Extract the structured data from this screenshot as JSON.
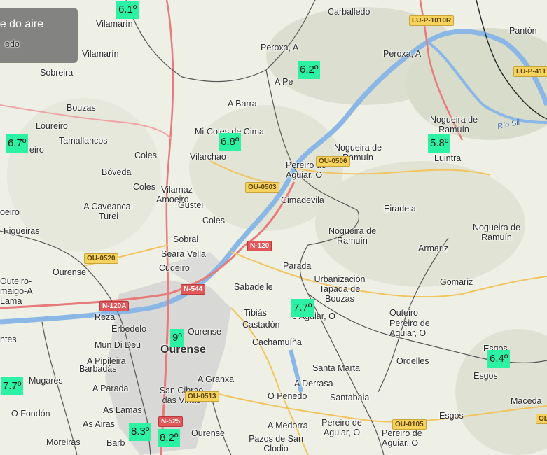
{
  "panel": {
    "title": "ade do aire"
  },
  "places": [
    {
      "id": "carballedo",
      "text": "Carballedo"
    },
    {
      "id": "panton",
      "text": "Pantón"
    },
    {
      "id": "peroxa-a-1",
      "text": "Peroxa, A"
    },
    {
      "id": "peroxa-a-2",
      "text": "Peroxa, A"
    },
    {
      "id": "vilamarin-1",
      "text": "Vilamarín"
    },
    {
      "id": "vilamarin-2",
      "text": "Vilamarín"
    },
    {
      "id": "edo",
      "text": "edo"
    },
    {
      "id": "sobreira",
      "text": "Sobreira"
    },
    {
      "id": "a-pereira",
      "text": "A Pe"
    },
    {
      "id": "a-barra",
      "text": "A Barra"
    },
    {
      "id": "bouzas",
      "text": "Bouzas"
    },
    {
      "id": "loureiro",
      "text": "Loureiro"
    },
    {
      "id": "coles-cima",
      "text": "Coles de Cima"
    },
    {
      "id": "micoles",
      "text": "Mi"
    },
    {
      "id": "nogueira-1",
      "text": "Nogueira de Ramuín"
    },
    {
      "id": "tamallancos",
      "text": "Tamallancos"
    },
    {
      "id": "coles-1",
      "text": "Coles"
    },
    {
      "id": "vilarchao",
      "text": "Vilarchao"
    },
    {
      "id": "nogueira-2",
      "text": "Nogueira de Ramuín"
    },
    {
      "id": "luintra",
      "text": "Luintra"
    },
    {
      "id": "loureiro-frag",
      "text": "eiro"
    },
    {
      "id": "pereiro-1",
      "text": "Pereiro de Aguiar, O"
    },
    {
      "id": "boveda",
      "text": "Bóveda"
    },
    {
      "id": "coles-2",
      "text": "Coles"
    },
    {
      "id": "vilarnaz",
      "text": "Vilarnaz"
    },
    {
      "id": "amoeiro",
      "text": "Amoeiro"
    },
    {
      "id": "gustei",
      "text": "Gustei"
    },
    {
      "id": "cimadevila",
      "text": "Cimadevila"
    },
    {
      "id": "eirig",
      "text": "oeiro"
    },
    {
      "id": "a-caveanca",
      "text": "A Caveanca-Turei"
    },
    {
      "id": "eirada",
      "text": "Eiradela"
    },
    {
      "id": "figueiras",
      "text": "Figueiras"
    },
    {
      "id": "coles-3",
      "text": "Coles"
    },
    {
      "id": "nogueira-3",
      "text": "Nogueira de Ramuín"
    },
    {
      "id": "nogueira-4",
      "text": "Nogueira de Ramuín"
    },
    {
      "id": "sobral",
      "text": "Sobral"
    },
    {
      "id": "seara-vella",
      "text": "Seara Vella"
    },
    {
      "id": "armariz",
      "text": "Armariz"
    },
    {
      "id": "outeiro-maigo",
      "text": "Outeiro-maigo-A Lama"
    },
    {
      "id": "ourense-1",
      "text": "Ourense"
    },
    {
      "id": "cudeiro",
      "text": "Cudeiro"
    },
    {
      "id": "parada",
      "text": "Parada"
    },
    {
      "id": "urbanizacion",
      "text": "Urbanización Tapada de Bouzas"
    },
    {
      "id": "gomariz",
      "text": "Gomariz"
    },
    {
      "id": "sabadelle",
      "text": "Sabadelle"
    },
    {
      "id": "outeiro-pereiro",
      "text": "Outeiro"
    },
    {
      "id": "pereiro-2",
      "text": "Pereiro de Aguiar, O"
    },
    {
      "id": "tibias",
      "text": "Tibiás"
    },
    {
      "id": "reza",
      "text": "Reza"
    },
    {
      "id": "castadon",
      "text": "Castadón"
    },
    {
      "id": "aguiar-frag",
      "text": "e Aguiar, O"
    },
    {
      "id": "ntes",
      "text": "ntes"
    },
    {
      "id": "erbedelo",
      "text": "Erbedelo"
    },
    {
      "id": "ourense-2",
      "text": "Ourense"
    },
    {
      "id": "mun-di-deu",
      "text": "Mun Di Deu"
    },
    {
      "id": "ourense-city",
      "text": "Ourense"
    },
    {
      "id": "cachamuina",
      "text": "Cachamuíña"
    },
    {
      "id": "esgos-1",
      "text": "Esgos"
    },
    {
      "id": "a-pipileira",
      "text": "A Pipileira"
    },
    {
      "id": "barbadas",
      "text": "Barbadás"
    },
    {
      "id": "santa-marta",
      "text": "Santa Marta"
    },
    {
      "id": "ordelles",
      "text": "Ordelles"
    },
    {
      "id": "esgos-2",
      "text": "Esgos"
    },
    {
      "id": "mugares",
      "text": "Mugares"
    },
    {
      "id": "a-granxa",
      "text": "A Granxa"
    },
    {
      "id": "a-derrasa",
      "text": "A Derrasa"
    },
    {
      "id": "a-parada",
      "text": "A Parada"
    },
    {
      "id": "san-cibrao",
      "text": "San Cibrao das Viñas"
    },
    {
      "id": "o-penedo",
      "text": "O Penedo"
    },
    {
      "id": "santabaia",
      "text": "Santabaia"
    },
    {
      "id": "maceda",
      "text": "Maceda"
    },
    {
      "id": "as-lamas",
      "text": "As Lamas"
    },
    {
      "id": "o-fondon",
      "text": "O Fondón"
    },
    {
      "id": "esgos-3",
      "text": "Esgos"
    },
    {
      "id": "as-airas",
      "text": "As Airas"
    },
    {
      "id": "a-medorra",
      "text": "A Medorra"
    },
    {
      "id": "pereiro-3",
      "text": "Pereiro de Aguiar, O"
    },
    {
      "id": "pereiro-4",
      "text": "Pereiro de Aguiar, O"
    },
    {
      "id": "moreiras",
      "text": "Moreiras"
    },
    {
      "id": "barbadas-2",
      "text": "Barb"
    },
    {
      "id": "ourense-3",
      "text": "Ourense"
    },
    {
      "id": "pazos",
      "text": "Pazos de San Clodio"
    }
  ],
  "roads": [
    {
      "id": "lu-p-1010r",
      "text": "LU-P-1010R",
      "kind": "yellow"
    },
    {
      "id": "lu-p-411",
      "text": "LU-P-411",
      "kind": "yellow"
    },
    {
      "id": "ou-0503",
      "text": "OU-0503",
      "kind": "yellow"
    },
    {
      "id": "ou-0506",
      "text": "OU-0506",
      "kind": "yellow"
    },
    {
      "id": "n-120",
      "text": "N-120",
      "kind": "red"
    },
    {
      "id": "ou-0520",
      "text": "OU-0520",
      "kind": "yellow"
    },
    {
      "id": "n-544",
      "text": "N-544",
      "kind": "red"
    },
    {
      "id": "n-120a",
      "text": "N-120A",
      "kind": "red"
    },
    {
      "id": "ou-0513",
      "text": "OU-0513",
      "kind": "yellow"
    },
    {
      "id": "n-525",
      "text": "N-525",
      "kind": "red"
    },
    {
      "id": "ou-0105",
      "text": "OU-0105",
      "kind": "yellow"
    },
    {
      "id": "ou-right",
      "text": "OL",
      "kind": "yellow"
    }
  ],
  "river_label": "Río Sil",
  "temperatures": [
    {
      "id": "t-vilamarin",
      "value": "6.1º"
    },
    {
      "id": "t-apereira",
      "value": "6.2º"
    },
    {
      "id": "t-loureiro",
      "value": "6.7º"
    },
    {
      "id": "t-coles",
      "value": "6.8º"
    },
    {
      "id": "t-luintra",
      "value": "5.8º"
    },
    {
      "id": "t-tapada",
      "value": "7.7º"
    },
    {
      "id": "t-ourense",
      "value": "9º"
    },
    {
      "id": "t-esgos",
      "value": "6.4º"
    },
    {
      "id": "t-mugares",
      "value": "7.7º"
    },
    {
      "id": "t-barbadas",
      "value": "8.3º"
    },
    {
      "id": "t-sancibrao",
      "value": "8.2º"
    }
  ],
  "colors": {
    "temp_badge": "#2cf2a4",
    "river": "#8bb7e6",
    "urban": "#c9c9c9",
    "national_road": "#e77a7a",
    "boundary": "#555555",
    "terrain": "#eef0e6"
  }
}
